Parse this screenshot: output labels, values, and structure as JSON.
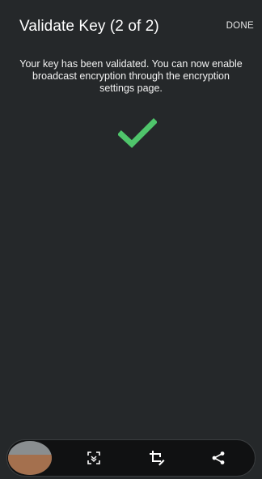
{
  "header": {
    "title": "Validate Key (2 of 2)",
    "done_label": "DONE"
  },
  "main": {
    "message": "Your key has been validated. You can now enable broadcast encryption through the encryption settings page.",
    "status_icon": "checkmark-icon",
    "accent_color": "#4fc56b"
  },
  "bottom_bar": {
    "items": [
      {
        "icon": "screenshot-thumbnail"
      },
      {
        "icon": "scroll-capture-icon"
      },
      {
        "icon": "crop-edit-icon"
      },
      {
        "icon": "share-icon"
      }
    ]
  }
}
